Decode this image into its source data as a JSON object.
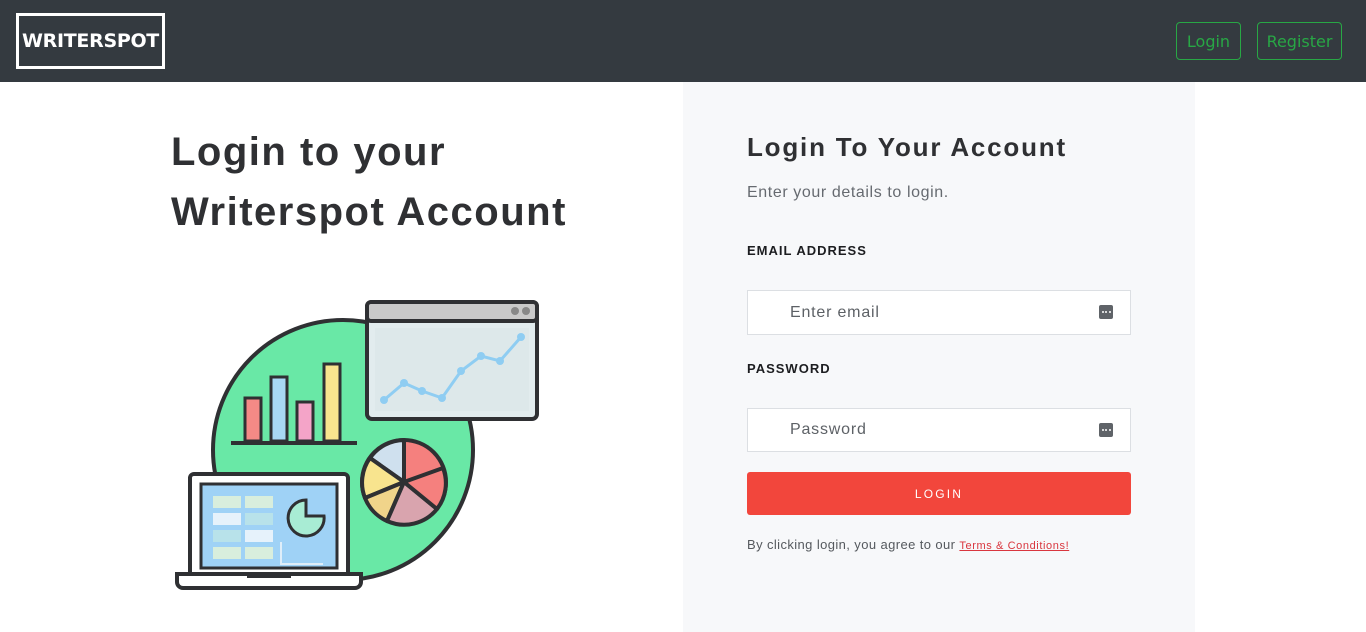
{
  "navbar": {
    "brand": "WRITERSPOT",
    "login_label": "Login",
    "register_label": "Register",
    "accent_color": "#28a745"
  },
  "hero": {
    "title_line1": "Login to your",
    "title_line2": "Writerspot Account"
  },
  "form": {
    "title": "Login To Your Account",
    "subtitle": "Enter your details to login.",
    "email_label": "EMAIL ADDRESS",
    "email_placeholder": "Enter email",
    "email_value": "",
    "password_label": "PASSWORD",
    "password_placeholder": "Password",
    "password_value": "",
    "field_icon": "password-manager-key-icon",
    "submit_label": "LOGIN",
    "submit_color": "#f2463c",
    "terms_prefix": "By clicking login, you agree to our",
    "terms_link": "Terms & Conditions!"
  }
}
